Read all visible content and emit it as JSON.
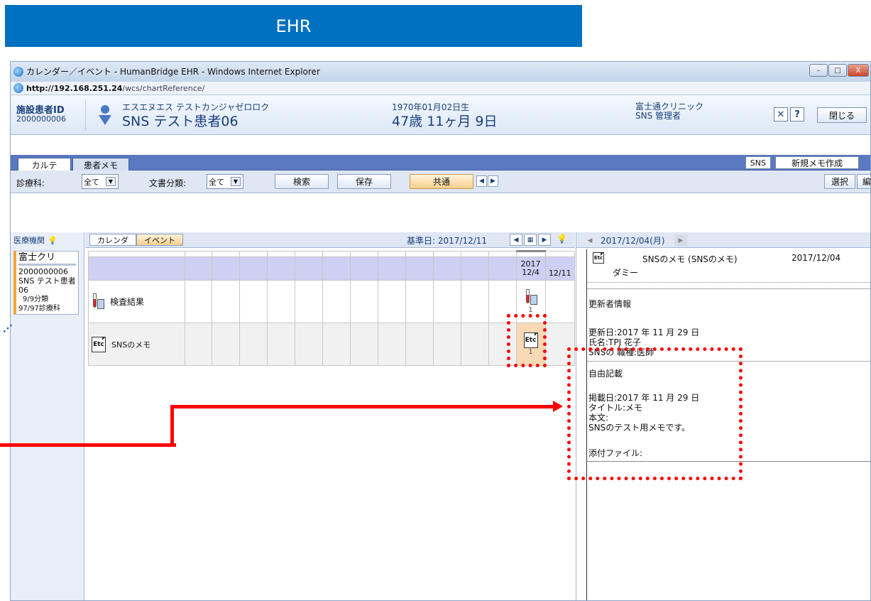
{
  "banner": {
    "title": "EHR"
  },
  "browser": {
    "window_title": "カレンダー／イベント - HumanBridge EHR - Windows Internet Explorer",
    "address_host": "http://192.168.251.24",
    "address_path": "/wcs/chartReference/",
    "min_label": "–",
    "max_label": "□",
    "close_label": "X"
  },
  "patient": {
    "id_label": "施設患者ID",
    "id_value": "2000000006",
    "name_kana": "エスエヌエス テストカンジャゼロロク",
    "name": "SNS テスト患者06",
    "dob": "1970年01月02日生",
    "age": "47歳 11ヶ月 9日",
    "clinic": "富士通クリニック",
    "user": "SNS 管理者",
    "tool_icon_1": "✕",
    "tool_icon_2": "?",
    "close_button": "閉じる"
  },
  "tabs": {
    "karte": "カルテ",
    "patient_memo": "患者メモ",
    "sns": "SNS",
    "new_memo": "新規メモ作成"
  },
  "filters": {
    "dept_label": "診療科:",
    "dept_value": "全て",
    "doc_label": "文書分類:",
    "doc_value": "全て",
    "search": "検索",
    "save": "保存",
    "common": "共通",
    "select": "選択",
    "edit": "編集"
  },
  "left": {
    "header": "医療機関",
    "org_name": "富士クリ",
    "patient_id": "2000000006",
    "patient_name": "SNS テスト患者06",
    "class_count": "9/9分類",
    "dept_count": "97/97診療科"
  },
  "main": {
    "view_calendar": "カレンダ",
    "view_event": "イベント",
    "base_date_label": "基準日:",
    "base_date": "2017/12/11",
    "col_year": "2017",
    "col_date1": "12/4",
    "col_date2": "12/11",
    "row1_label": "検査結果",
    "row1_count": "1",
    "row2_label": "SNSのメモ",
    "row2_count": "1"
  },
  "detail": {
    "date": "2017/12/04(月)",
    "title": "SNSのメモ (SNSのメモ)",
    "title_date": "2017/12/04",
    "sub": "ダミー",
    "updater_header": "更新者情報",
    "update_date": "更新日:2017 年 11 月 29 日",
    "name": "氏名:TPJ 花子",
    "role": "SNSの 職種:医師",
    "free_header": "自由記載",
    "post_date": "掲載日:2017 年 11 月 29 日",
    "memo_title": "タイトル:メモ",
    "body_label": "本文:",
    "body_text": "SNSのテスト用メモです。",
    "attachment": "添付ファイル:"
  },
  "colors": {
    "banner": "#0070c0",
    "annotation": "#ff0000",
    "tab_bar": "#5b79c0",
    "highlight_button": "#f6cf8e"
  }
}
